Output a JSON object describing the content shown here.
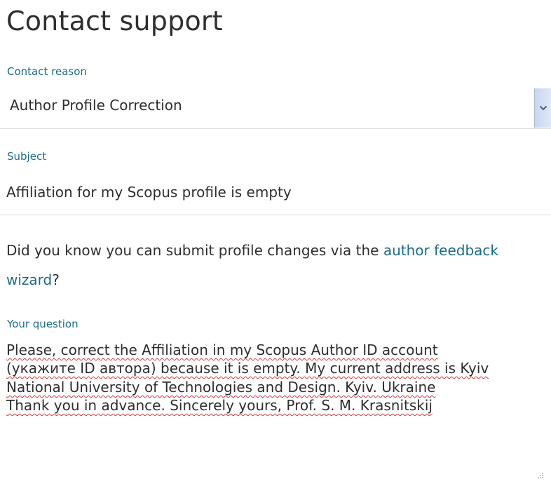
{
  "page": {
    "title": "Contact support"
  },
  "contact_reason": {
    "label": "Contact reason",
    "selected": "Author Profile Correction"
  },
  "subject": {
    "label": "Subject",
    "value": "Affiliation for my Scopus profile is empty"
  },
  "info": {
    "text_before": "Did you know you can submit profile changes via the ",
    "link_text": "author feedback wizard",
    "text_after": "?"
  },
  "question": {
    "label": "Your question",
    "lines": [
      "Please, correct the Affiliation in my Scopus Author ID account",
      "(укажите ID автора) because it is empty. My current address is Kyiv",
      "National University of Technologies and Design. Kyiv. Ukraine",
      "Thank you in advance. Sincerely yours, Prof. S. M. Krasnitskij"
    ]
  },
  "colors": {
    "label": "#1b6b8a",
    "link": "#1b6b8a",
    "text": "#2e2e2e",
    "divider": "#d9d9d9",
    "spellcheck": "#d43a3a"
  },
  "icons": {
    "dropdown": "chevron-down-icon",
    "resize": "resize-grip-icon"
  }
}
